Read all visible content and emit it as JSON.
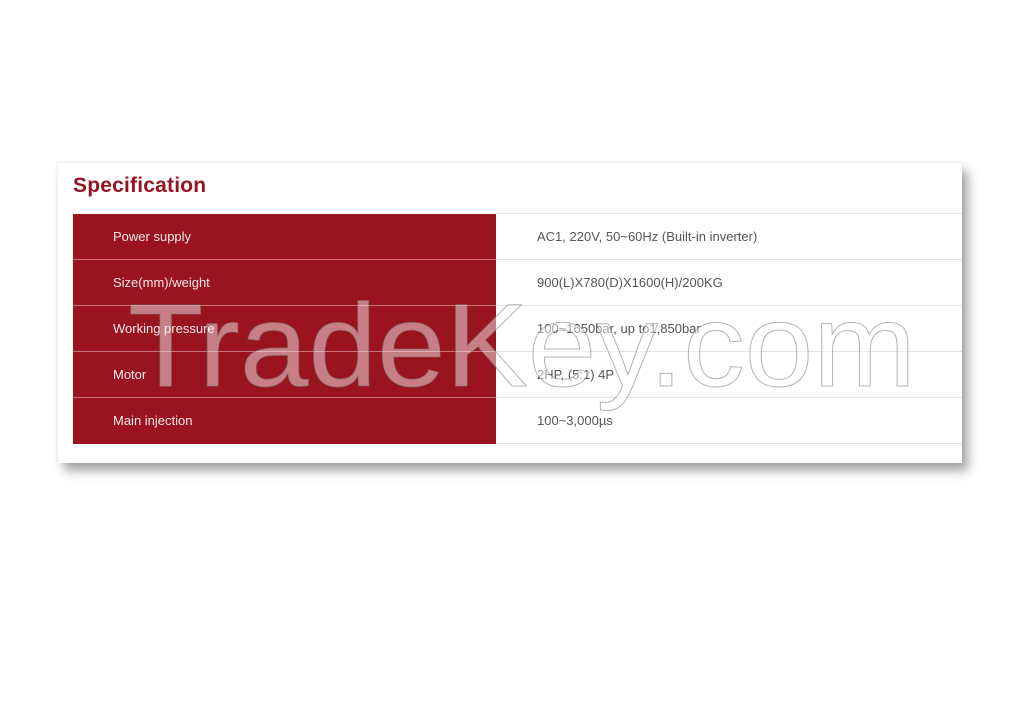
{
  "section": {
    "title": "Specification"
  },
  "specs": [
    {
      "label": "Power supply",
      "value": "AC1, 220V, 50~60Hz (Built-in inverter)"
    },
    {
      "label": "Size(mm)/weight",
      "value": "900(L)X780(D)X1600(H)/200KG"
    },
    {
      "label": "Working pressure",
      "value": "100~1650bar, up to1,850bar"
    },
    {
      "label": "Motor",
      "value": "2HP, (5:1) 4P"
    },
    {
      "label": "Main injection",
      "value": "100~3,000µs"
    }
  ],
  "watermark": {
    "text": "TradeKey.com"
  },
  "colors": {
    "accent": "#9a1420",
    "title": "#961422",
    "value_text": "#555555"
  }
}
